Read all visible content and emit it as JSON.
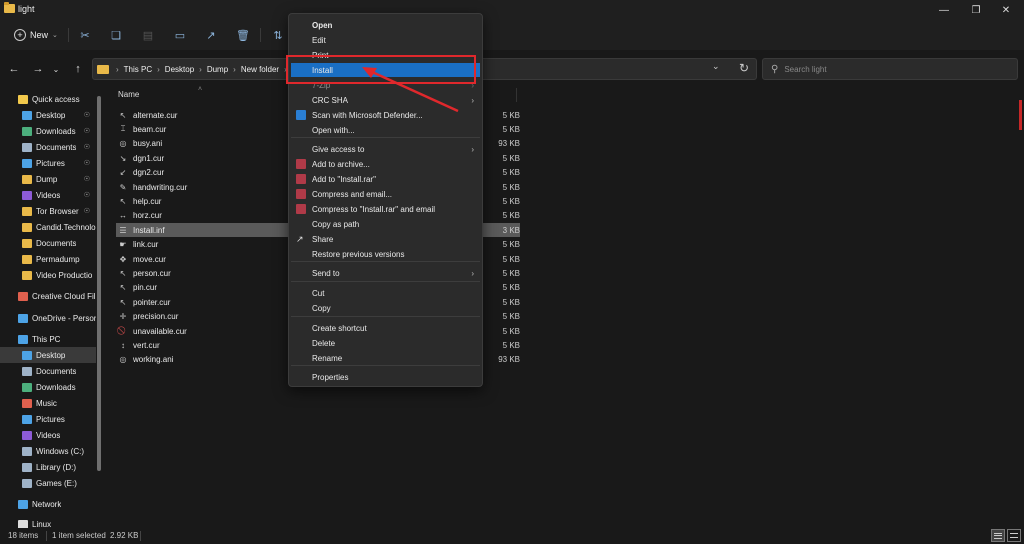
{
  "window": {
    "title": "light"
  },
  "command_bar": {
    "new_label": "New"
  },
  "address": {
    "segments": [
      "This PC",
      "Desktop",
      "Dump",
      "New folder"
    ]
  },
  "search": {
    "placeholder": "Search light"
  },
  "sidebar": {
    "items": [
      {
        "label": "Quick access",
        "color": "#f2c94c"
      },
      {
        "label": "Desktop",
        "color": "#4da3e6"
      },
      {
        "label": "Downloads",
        "color": "#4caf7d"
      },
      {
        "label": "Documents",
        "color": "#9fb3c8"
      },
      {
        "label": "Pictures",
        "color": "#4da3e6"
      },
      {
        "label": "Dump",
        "color": "#e9b949"
      },
      {
        "label": "Videos",
        "color": "#8e5bd6"
      },
      {
        "label": "Tor Browser",
        "color": "#e9b949"
      },
      {
        "label": "Candid.Technolo",
        "color": "#e9b949"
      },
      {
        "label": "Documents",
        "color": "#e9b949"
      },
      {
        "label": "Permadump",
        "color": "#e9b949"
      },
      {
        "label": "Video Productio",
        "color": "#e9b949"
      },
      {
        "label": "Creative Cloud Fil",
        "color": "#e0604e"
      },
      {
        "label": "OneDrive - Persor",
        "color": "#4da3e6"
      },
      {
        "label": "This PC",
        "color": "#4da3e6"
      },
      {
        "label": "Desktop",
        "color": "#4da3e6"
      },
      {
        "label": "Documents",
        "color": "#9fb3c8"
      },
      {
        "label": "Downloads",
        "color": "#4caf7d"
      },
      {
        "label": "Music",
        "color": "#e0604e"
      },
      {
        "label": "Pictures",
        "color": "#4da3e6"
      },
      {
        "label": "Videos",
        "color": "#8e5bd6"
      },
      {
        "label": "Windows (C:)",
        "color": "#9fb3c8"
      },
      {
        "label": "Library (D:)",
        "color": "#9fb3c8"
      },
      {
        "label": "Games (E:)",
        "color": "#9fb3c8"
      },
      {
        "label": "Network",
        "color": "#4da3e6"
      },
      {
        "label": "Linux",
        "color": "#dddddd"
      }
    ]
  },
  "file_list": {
    "column_name": "Name",
    "files": [
      {
        "name": "alternate.cur",
        "size": "5 KB"
      },
      {
        "name": "beam.cur",
        "size": "5 KB"
      },
      {
        "name": "busy.ani",
        "size": "93 KB"
      },
      {
        "name": "dgn1.cur",
        "size": "5 KB"
      },
      {
        "name": "dgn2.cur",
        "size": "5 KB"
      },
      {
        "name": "handwriting.cur",
        "size": "5 KB"
      },
      {
        "name": "help.cur",
        "size": "5 KB"
      },
      {
        "name": "horz.cur",
        "size": "5 KB"
      },
      {
        "name": "Install.inf",
        "size": "3 KB"
      },
      {
        "name": "link.cur",
        "size": "5 KB"
      },
      {
        "name": "move.cur",
        "size": "5 KB"
      },
      {
        "name": "person.cur",
        "size": "5 KB"
      },
      {
        "name": "pin.cur",
        "size": "5 KB"
      },
      {
        "name": "pointer.cur",
        "size": "5 KB"
      },
      {
        "name": "precision.cur",
        "size": "5 KB"
      },
      {
        "name": "unavailable.cur",
        "size": "5 KB"
      },
      {
        "name": "vert.cur",
        "size": "5 KB"
      },
      {
        "name": "working.ani",
        "size": "93 KB"
      }
    ]
  },
  "context_menu": {
    "items": [
      {
        "label": "Open"
      },
      {
        "label": "Edit"
      },
      {
        "label": "Print"
      },
      {
        "label": "Install"
      },
      {
        "label": "7-Zip"
      },
      {
        "label": "CRC SHA"
      },
      {
        "label": "Scan with Microsoft Defender..."
      },
      {
        "label": "Open with..."
      },
      {
        "label": "Give access to"
      },
      {
        "label": "Add to archive..."
      },
      {
        "label": "Add to \"Install.rar\""
      },
      {
        "label": "Compress and email..."
      },
      {
        "label": "Compress to \"Install.rar\" and email"
      },
      {
        "label": "Copy as path"
      },
      {
        "label": "Share"
      },
      {
        "label": "Restore previous versions"
      },
      {
        "label": "Send to"
      },
      {
        "label": "Cut"
      },
      {
        "label": "Copy"
      },
      {
        "label": "Create shortcut"
      },
      {
        "label": "Delete"
      },
      {
        "label": "Rename"
      },
      {
        "label": "Properties"
      }
    ],
    "highlight_color": "#1a6fc4"
  },
  "status_bar": {
    "item_count": "18 items",
    "selection": "1 item selected",
    "selection_size": "2.92 KB"
  },
  "colors": {
    "annotation": "#e0282c",
    "accent": "#1a6fc4"
  }
}
